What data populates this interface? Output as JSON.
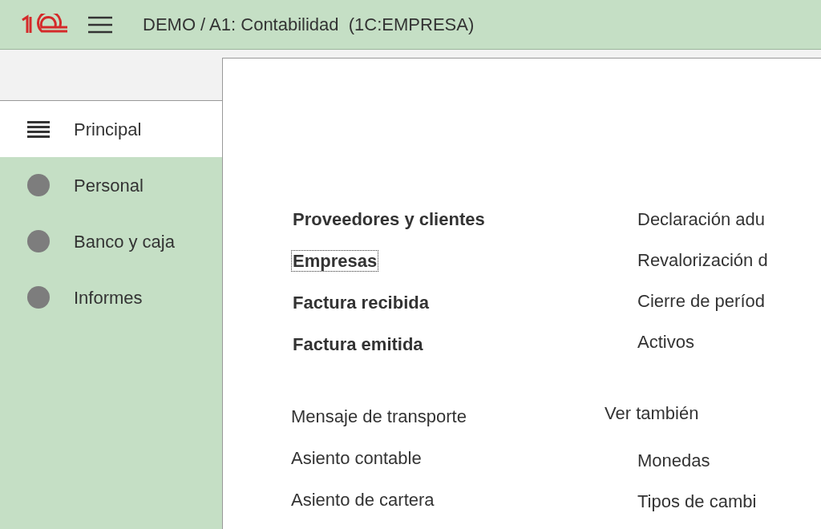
{
  "header": {
    "title": "DEMO / A1: Contabilidad  (1C:EMPRESA)"
  },
  "sidebar": {
    "items": [
      {
        "label": "Principal",
        "kind": "list",
        "selected": true
      },
      {
        "label": "Personal",
        "kind": "dot",
        "selected": false
      },
      {
        "label": "Banco y caja",
        "kind": "dot",
        "selected": false
      },
      {
        "label": "Informes",
        "kind": "dot",
        "selected": false
      }
    ]
  },
  "main": {
    "primary_links": [
      {
        "label": "Proveedores y clientes",
        "focused": false
      },
      {
        "label": "Empresas",
        "focused": true
      },
      {
        "label": "Factura recibida",
        "focused": false
      },
      {
        "label": "Factura emitida",
        "focused": false
      }
    ],
    "secondary_links": [
      "Mensaje de transporte",
      "Asiento contable",
      "Asiento de cartera"
    ],
    "right_links": [
      "Declaración adu",
      "Revalorización d",
      "Cierre de períod",
      "Activos"
    ],
    "see_also": {
      "title": "Ver también",
      "links": [
        "Monedas",
        "Tipos de cambi"
      ]
    }
  }
}
